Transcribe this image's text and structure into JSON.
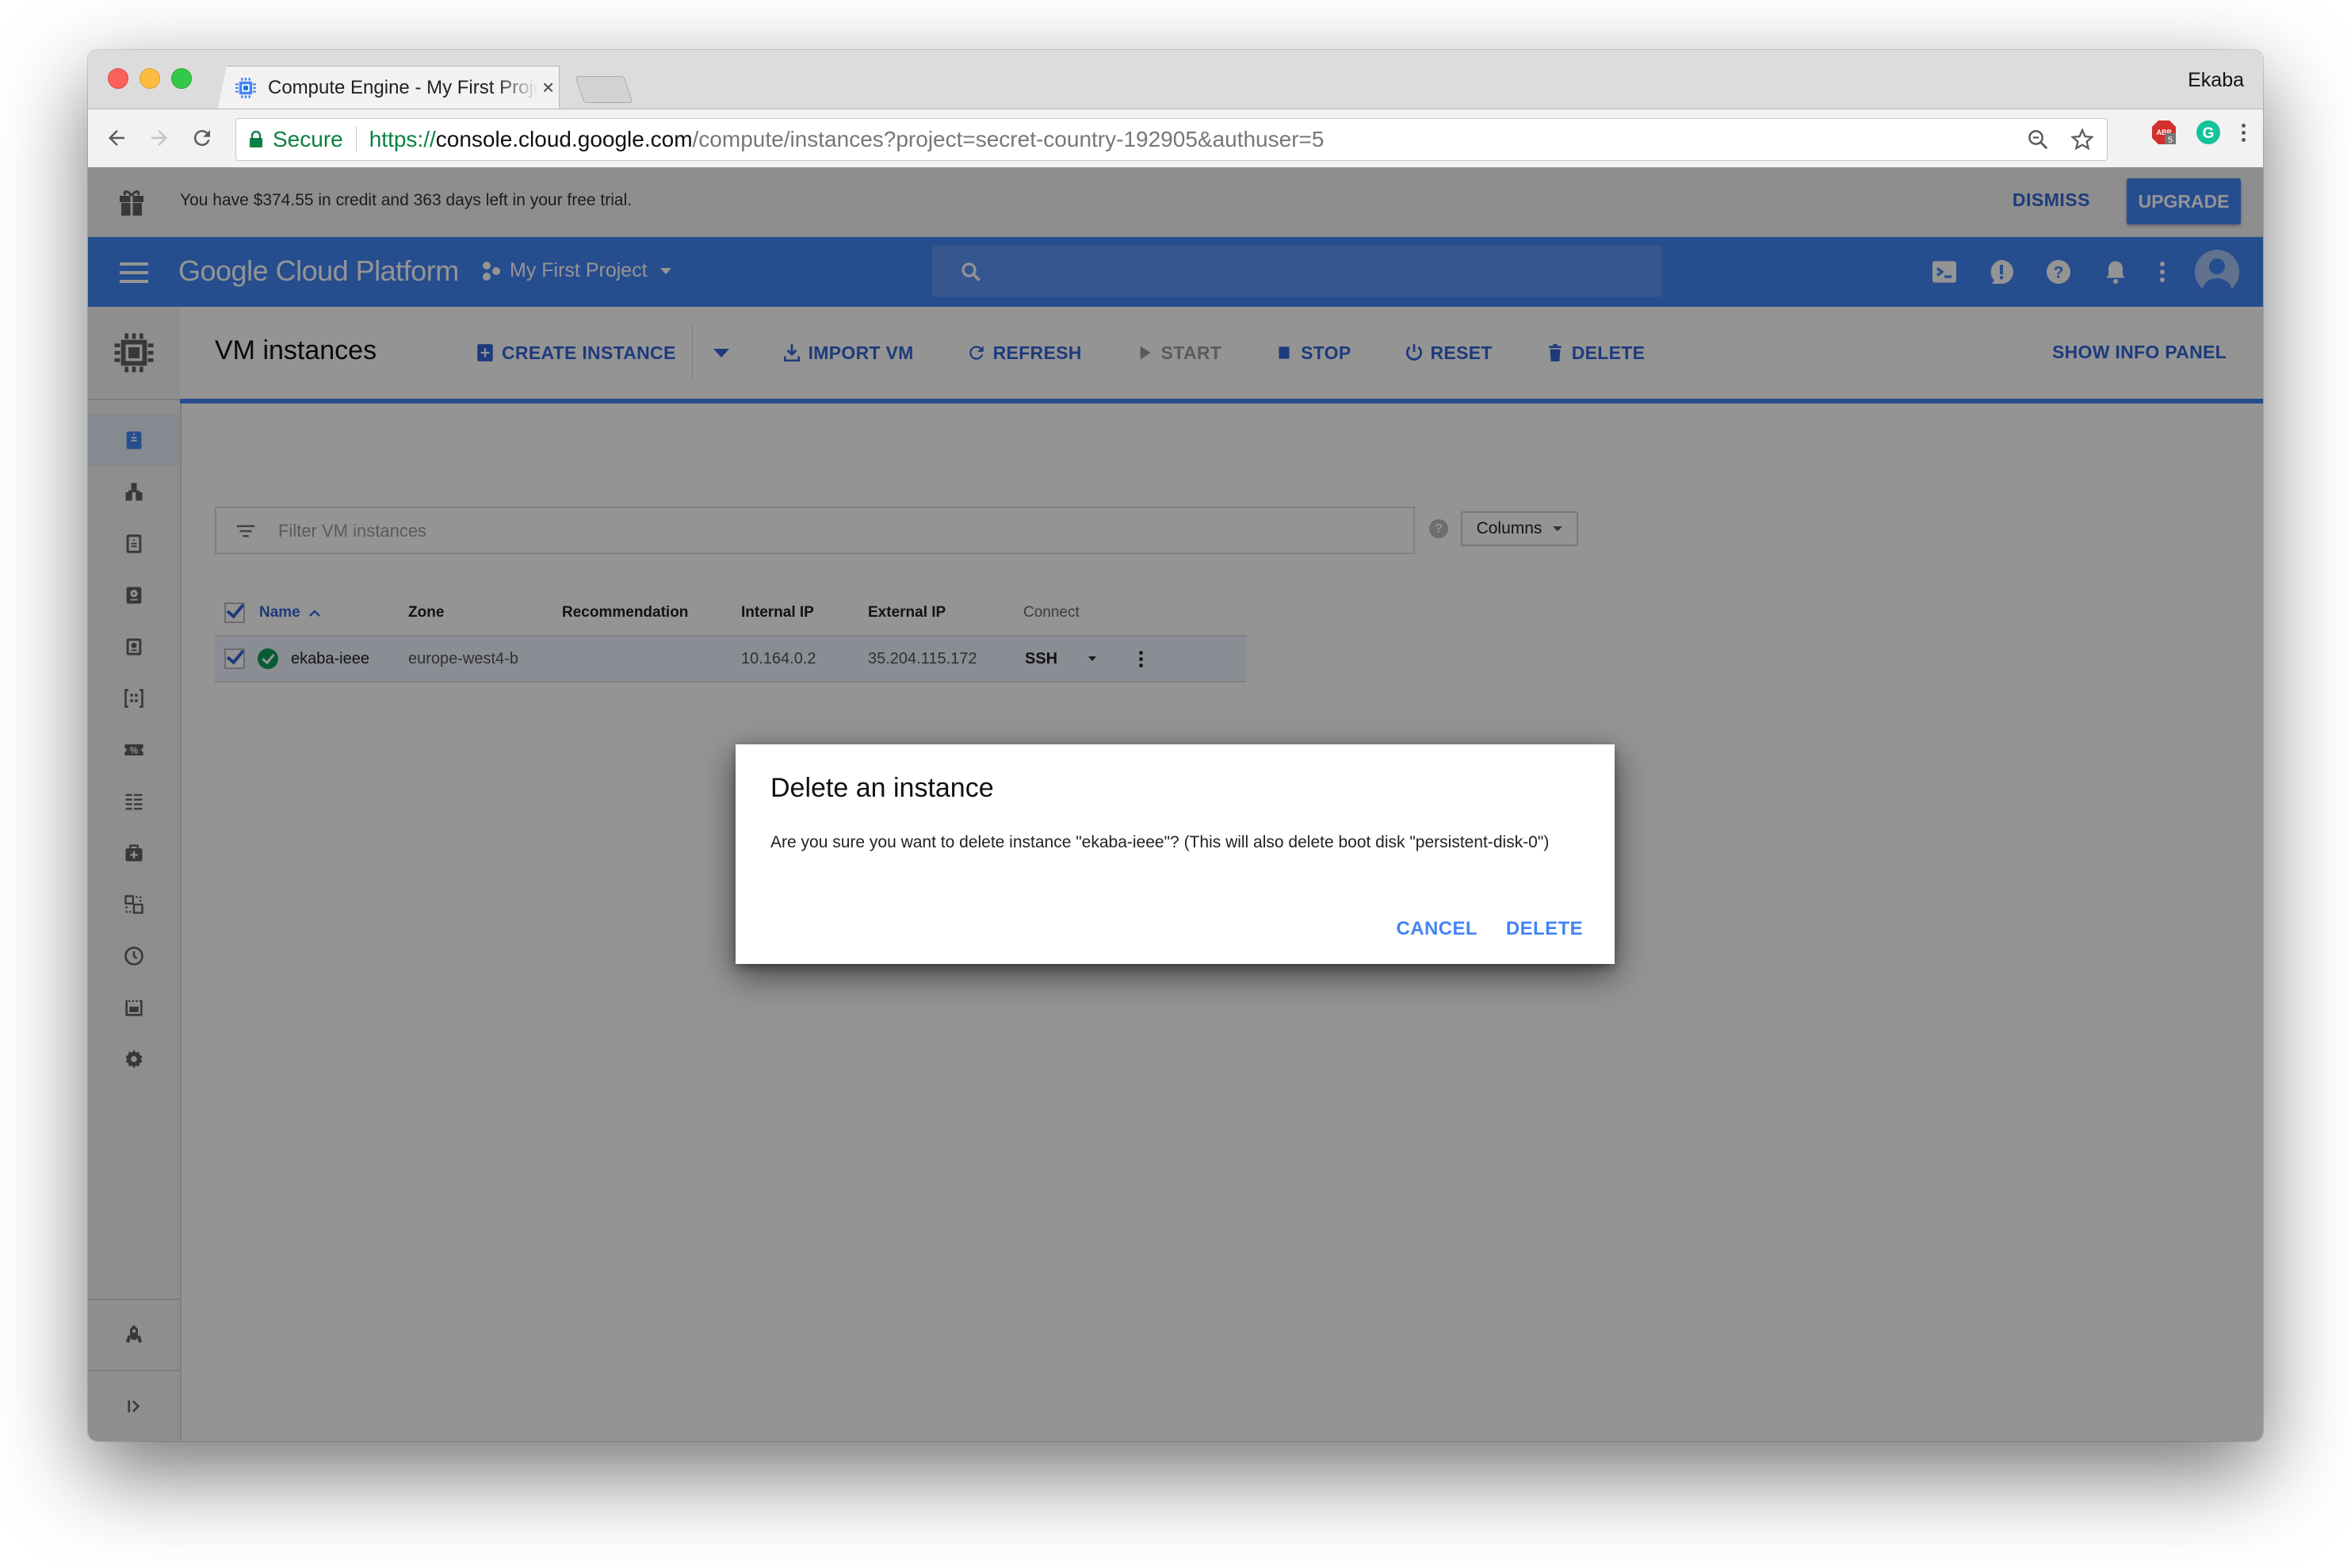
{
  "browser": {
    "tab_title": "Compute Engine - My First Project",
    "tab_close": "×",
    "profile_name": "Ekaba",
    "secure_label": "Secure",
    "url": {
      "scheme": "https://",
      "host": "console.cloud.google.com",
      "path": "/compute/instances?project=secret-country-192905&authuser=5"
    },
    "nav": {
      "back": "←",
      "forward": "→",
      "reload": "↻"
    },
    "extensions": [
      {
        "name": "adblock",
        "badge": "5",
        "color": "#d32f2f"
      },
      {
        "name": "grammarly",
        "label": "G",
        "color": "#15c39a"
      }
    ]
  },
  "trial_banner": {
    "message": "You have $374.55 in credit and 363 days left in your free trial.",
    "dismiss_label": "DISMISS",
    "upgrade_label": "UPGRADE"
  },
  "header": {
    "product_name": "Google Cloud Platform",
    "project_name": "My First Project",
    "search_placeholder": "",
    "icons": [
      "cloud-shell-icon",
      "feedback-icon",
      "help-icon",
      "notifications-icon",
      "more-vert-icon",
      "account-avatar"
    ]
  },
  "sidebar": {
    "product_icon": "compute-engine-icon",
    "items": [
      {
        "name": "vm-instances",
        "active": true
      },
      {
        "name": "instance-groups",
        "active": false
      },
      {
        "name": "instance-templates",
        "active": false
      },
      {
        "name": "disks",
        "active": false
      },
      {
        "name": "snapshots",
        "active": false
      },
      {
        "name": "images",
        "active": false
      },
      {
        "name": "committed-use-discounts",
        "active": false
      },
      {
        "name": "metadata",
        "active": false
      },
      {
        "name": "health-checks",
        "active": false
      },
      {
        "name": "zones",
        "active": false
      },
      {
        "name": "operations",
        "active": false
      },
      {
        "name": "quotas",
        "active": false
      },
      {
        "name": "settings",
        "active": false
      }
    ],
    "bottom": [
      "marketplace",
      "collapse"
    ]
  },
  "page": {
    "title": "VM instances",
    "actions": [
      {
        "label": "CREATE INSTANCE",
        "icon": "add-box-icon",
        "enabled": true
      },
      {
        "label": "IMPORT VM",
        "icon": "import-icon",
        "enabled": true
      },
      {
        "label": "REFRESH",
        "icon": "refresh-icon",
        "enabled": true
      },
      {
        "label": "START",
        "icon": "play-icon",
        "enabled": false
      },
      {
        "label": "STOP",
        "icon": "stop-icon",
        "enabled": true
      },
      {
        "label": "RESET",
        "icon": "power-icon",
        "enabled": true
      },
      {
        "label": "DELETE",
        "icon": "trash-icon",
        "enabled": true
      }
    ],
    "show_info_panel_label": "SHOW INFO PANEL",
    "filter_placeholder": "Filter VM instances",
    "columns_label": "Columns"
  },
  "table": {
    "columns": [
      "Name",
      "Zone",
      "Recommendation",
      "Internal IP",
      "External IP",
      "Connect"
    ],
    "sort_indicator": "^",
    "rows": [
      {
        "selected": true,
        "status": "running",
        "name": "ekaba-ieee",
        "zone": "europe-west4-b",
        "recommendation": "",
        "internal_ip": "10.164.0.2",
        "external_ip": "35.204.115.172",
        "connect": "SSH"
      }
    ]
  },
  "dialog": {
    "title": "Delete an instance",
    "message": "Are you sure you want to delete instance \"ekaba-ieee\"? (This will also delete boot disk \"persistent-disk-0\")",
    "cancel_label": "CANCEL",
    "confirm_label": "DELETE"
  },
  "colors": {
    "brand_blue": "#4285f4",
    "link_blue": "#3367d6",
    "status_green": "#0f9d58",
    "scrim": "rgba(0,0,0,0.42)"
  }
}
